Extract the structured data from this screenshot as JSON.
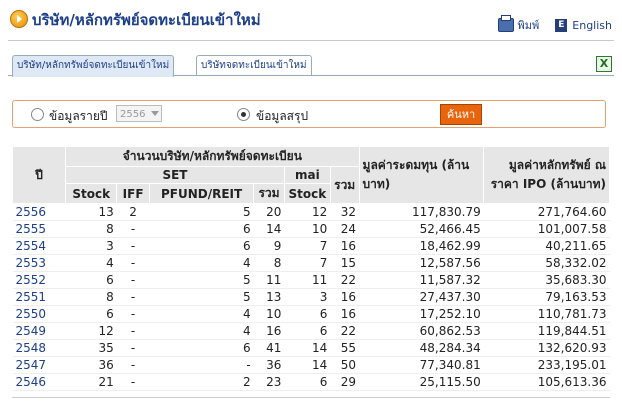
{
  "header": {
    "title": "บริษัท/หลักทรัพย์จดทะเบียนเข้าใหม่",
    "print_label": "พิมพ์",
    "english_label": "English"
  },
  "tabs": [
    {
      "label": "บริษัท/หลักทรัพย์จดทะเบียนเข้าใหม่",
      "active": true
    },
    {
      "label": "บริษัทจดทะเบียนเข้าใหม่",
      "active": false
    }
  ],
  "filter": {
    "yearly_label": "ข้อมูลรายปี",
    "year_value": "2556",
    "summary_label": "ข้อมูลสรุป",
    "search_button": "ค้นหา"
  },
  "table": {
    "h_year": "ปี",
    "h_group": "จำนวนบริษัท/หลักทรัพย์จดทะเบียน",
    "h_set": "SET",
    "h_mai": "mai",
    "h_total": "รวม",
    "h_stock": "Stock",
    "h_iff": "IFF",
    "h_pfund": "PFUND/REIT",
    "h_set_total": "รวม",
    "h_mai_stock": "Stock",
    "h_mcap": "มูลค่าระดมทุน (ล้านบาท)",
    "h_ipo": "มูลค่าหลักทรัพย์ ณ ราคา IPO (ล้านบาท)",
    "rows": [
      {
        "year": "2556",
        "stock": "13",
        "iff": "2",
        "pfund": "5",
        "set_total": "20",
        "mai_stock": "12",
        "total": "32",
        "raise": "117,830.79",
        "ipo": "271,764.60"
      },
      {
        "year": "2555",
        "stock": "8",
        "iff": "-",
        "pfund": "6",
        "set_total": "14",
        "mai_stock": "10",
        "total": "24",
        "raise": "52,466.45",
        "ipo": "101,007.58"
      },
      {
        "year": "2554",
        "stock": "3",
        "iff": "-",
        "pfund": "6",
        "set_total": "9",
        "mai_stock": "7",
        "total": "16",
        "raise": "18,462.99",
        "ipo": "40,211.65"
      },
      {
        "year": "2553",
        "stock": "4",
        "iff": "-",
        "pfund": "4",
        "set_total": "8",
        "mai_stock": "7",
        "total": "15",
        "raise": "12,587.56",
        "ipo": "58,332.02"
      },
      {
        "year": "2552",
        "stock": "6",
        "iff": "-",
        "pfund": "5",
        "set_total": "11",
        "mai_stock": "11",
        "total": "22",
        "raise": "11,587.32",
        "ipo": "35,683.30"
      },
      {
        "year": "2551",
        "stock": "8",
        "iff": "-",
        "pfund": "5",
        "set_total": "13",
        "mai_stock": "3",
        "total": "16",
        "raise": "27,437.30",
        "ipo": "79,163.53"
      },
      {
        "year": "2550",
        "stock": "6",
        "iff": "-",
        "pfund": "4",
        "set_total": "10",
        "mai_stock": "6",
        "total": "16",
        "raise": "17,252.10",
        "ipo": "110,781.73"
      },
      {
        "year": "2549",
        "stock": "12",
        "iff": "-",
        "pfund": "4",
        "set_total": "16",
        "mai_stock": "6",
        "total": "22",
        "raise": "60,862.53",
        "ipo": "119,844.51"
      },
      {
        "year": "2548",
        "stock": "35",
        "iff": "-",
        "pfund": "6",
        "set_total": "41",
        "mai_stock": "14",
        "total": "55",
        "raise": "48,284.34",
        "ipo": "132,620.93"
      },
      {
        "year": "2547",
        "stock": "36",
        "iff": "-",
        "pfund": "-",
        "set_total": "36",
        "mai_stock": "14",
        "total": "50",
        "raise": "77,340.81",
        "ipo": "233,195.01"
      },
      {
        "year": "2546",
        "stock": "21",
        "iff": "-",
        "pfund": "2",
        "set_total": "23",
        "mai_stock": "6",
        "total": "29",
        "raise": "25,115.50",
        "ipo": "105,613.36"
      }
    ]
  }
}
